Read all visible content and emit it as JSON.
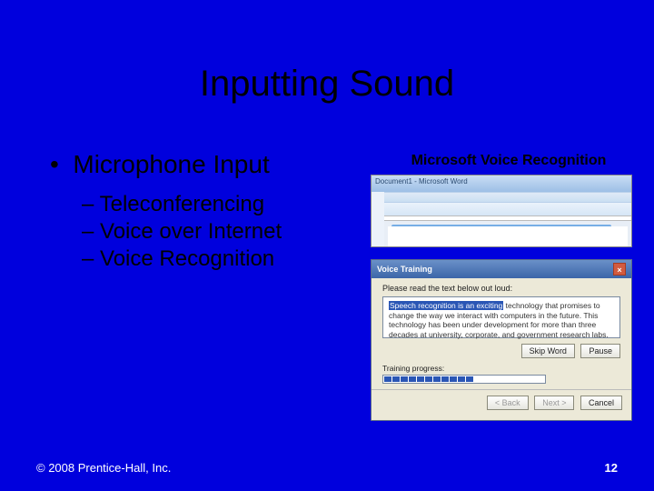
{
  "slide": {
    "title": "Inputting Sound",
    "bullet": "Microphone Input",
    "subs": [
      "Teleconferencing",
      "Voice over Internet",
      "Voice Recognition"
    ],
    "image_label": "Microsoft Voice Recognition"
  },
  "word": {
    "title": "Document1 - Microsoft Word"
  },
  "wizard": {
    "title": "Voice Training",
    "instruction": "Please read the text below out loud:",
    "highlight": "Speech recognition is an exciting",
    "rest": " technology that promises to change the way we interact with computers in the future. This technology has been under development for more than three decades at university, corporate, and government research labs.",
    "skip": "Skip Word",
    "pause": "Pause",
    "progress_label": "Training progress:",
    "back": "< Back",
    "next": "Next >",
    "cancel": "Cancel"
  },
  "footer": {
    "copyright": "© 2008 Prentice-Hall, Inc.",
    "page": "12"
  }
}
